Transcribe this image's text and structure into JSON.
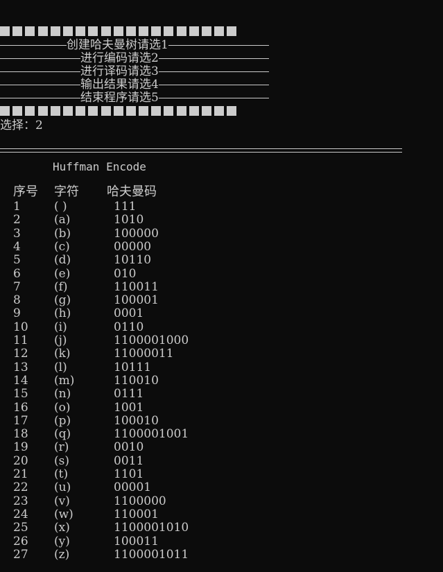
{
  "menu": {
    "blocks_count": 19,
    "items": [
      {
        "label": "创建哈夫曼树请选1"
      },
      {
        "label": "进行编码请选2"
      },
      {
        "label": "进行译码请选3"
      },
      {
        "label": "输出结果请选4"
      },
      {
        "label": "结束程序请选5"
      }
    ]
  },
  "prompt": {
    "text": "选择：2"
  },
  "encode": {
    "title": "Huffman Encode",
    "headers": {
      "index": "序号",
      "char": "字符",
      "code": "哈夫曼码"
    },
    "rows": [
      {
        "index": "1",
        "char": "( )",
        "code": "111"
      },
      {
        "index": "2",
        "char": "(a)",
        "code": "1010"
      },
      {
        "index": "3",
        "char": "(b)",
        "code": "100000"
      },
      {
        "index": "4",
        "char": "(c)",
        "code": "00000"
      },
      {
        "index": "5",
        "char": "(d)",
        "code": "10110"
      },
      {
        "index": "6",
        "char": "(e)",
        "code": "010"
      },
      {
        "index": "7",
        "char": "(f)",
        "code": "110011"
      },
      {
        "index": "8",
        "char": "(g)",
        "code": "100001"
      },
      {
        "index": "9",
        "char": "(h)",
        "code": "0001"
      },
      {
        "index": "10",
        "char": "(i)",
        "code": "0110"
      },
      {
        "index": "11",
        "char": "(j)",
        "code": "1100001000"
      },
      {
        "index": "12",
        "char": "(k)",
        "code": "11000011"
      },
      {
        "index": "13",
        "char": "(l)",
        "code": "10111"
      },
      {
        "index": "14",
        "char": "(m)",
        "code": "110010"
      },
      {
        "index": "15",
        "char": "(n)",
        "code": "0111"
      },
      {
        "index": "16",
        "char": "(o)",
        "code": "1001"
      },
      {
        "index": "17",
        "char": "(p)",
        "code": "100010"
      },
      {
        "index": "18",
        "char": "(q)",
        "code": "1100001001"
      },
      {
        "index": "19",
        "char": "(r)",
        "code": "0010"
      },
      {
        "index": "20",
        "char": "(s)",
        "code": "0011"
      },
      {
        "index": "21",
        "char": "(t)",
        "code": "1101"
      },
      {
        "index": "22",
        "char": "(u)",
        "code": "00001"
      },
      {
        "index": "23",
        "char": "(v)",
        "code": "1100000"
      },
      {
        "index": "24",
        "char": "(w)",
        "code": "110001"
      },
      {
        "index": "25",
        "char": "(x)",
        "code": "1100001010"
      },
      {
        "index": "26",
        "char": "(y)",
        "code": "100011"
      },
      {
        "index": "27",
        "char": "(z)",
        "code": "1100001011"
      }
    ]
  },
  "colors": {
    "background": "#0c0c0c",
    "text": "#cccccc"
  }
}
